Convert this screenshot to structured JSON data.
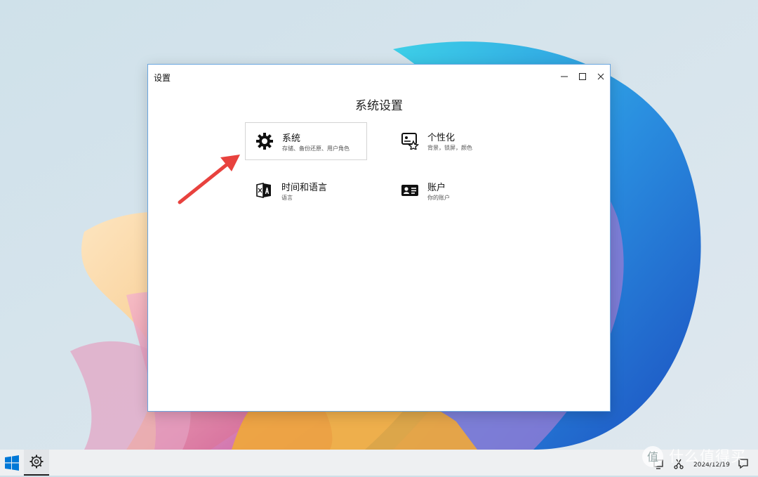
{
  "window": {
    "title": "设置",
    "controls": [
      "minimize-icon",
      "maximize-icon",
      "close-icon"
    ]
  },
  "page": {
    "heading": "系统设置"
  },
  "cards": [
    {
      "name": "系统",
      "desc": "存储、备份还原、用户角色",
      "icon": "gear-icon",
      "selected": true
    },
    {
      "name": "个性化",
      "desc": "背景，锁屏，颜色",
      "icon": "personalize-icon",
      "selected": false
    },
    {
      "name": "时间和语言",
      "desc": "语言",
      "icon": "language-icon",
      "selected": false
    },
    {
      "name": "账户",
      "desc": "你的账户",
      "icon": "account-card-icon",
      "selected": false
    }
  ],
  "annotation": {
    "color": "#e8423e"
  },
  "taskbar": {
    "start_icon": "windows-logo-icon",
    "pinned": [
      "settings-gear-icon"
    ],
    "clock_date": "2024/12/19",
    "accent": "#0078d7"
  },
  "watermark": {
    "text": "什么值得买"
  }
}
